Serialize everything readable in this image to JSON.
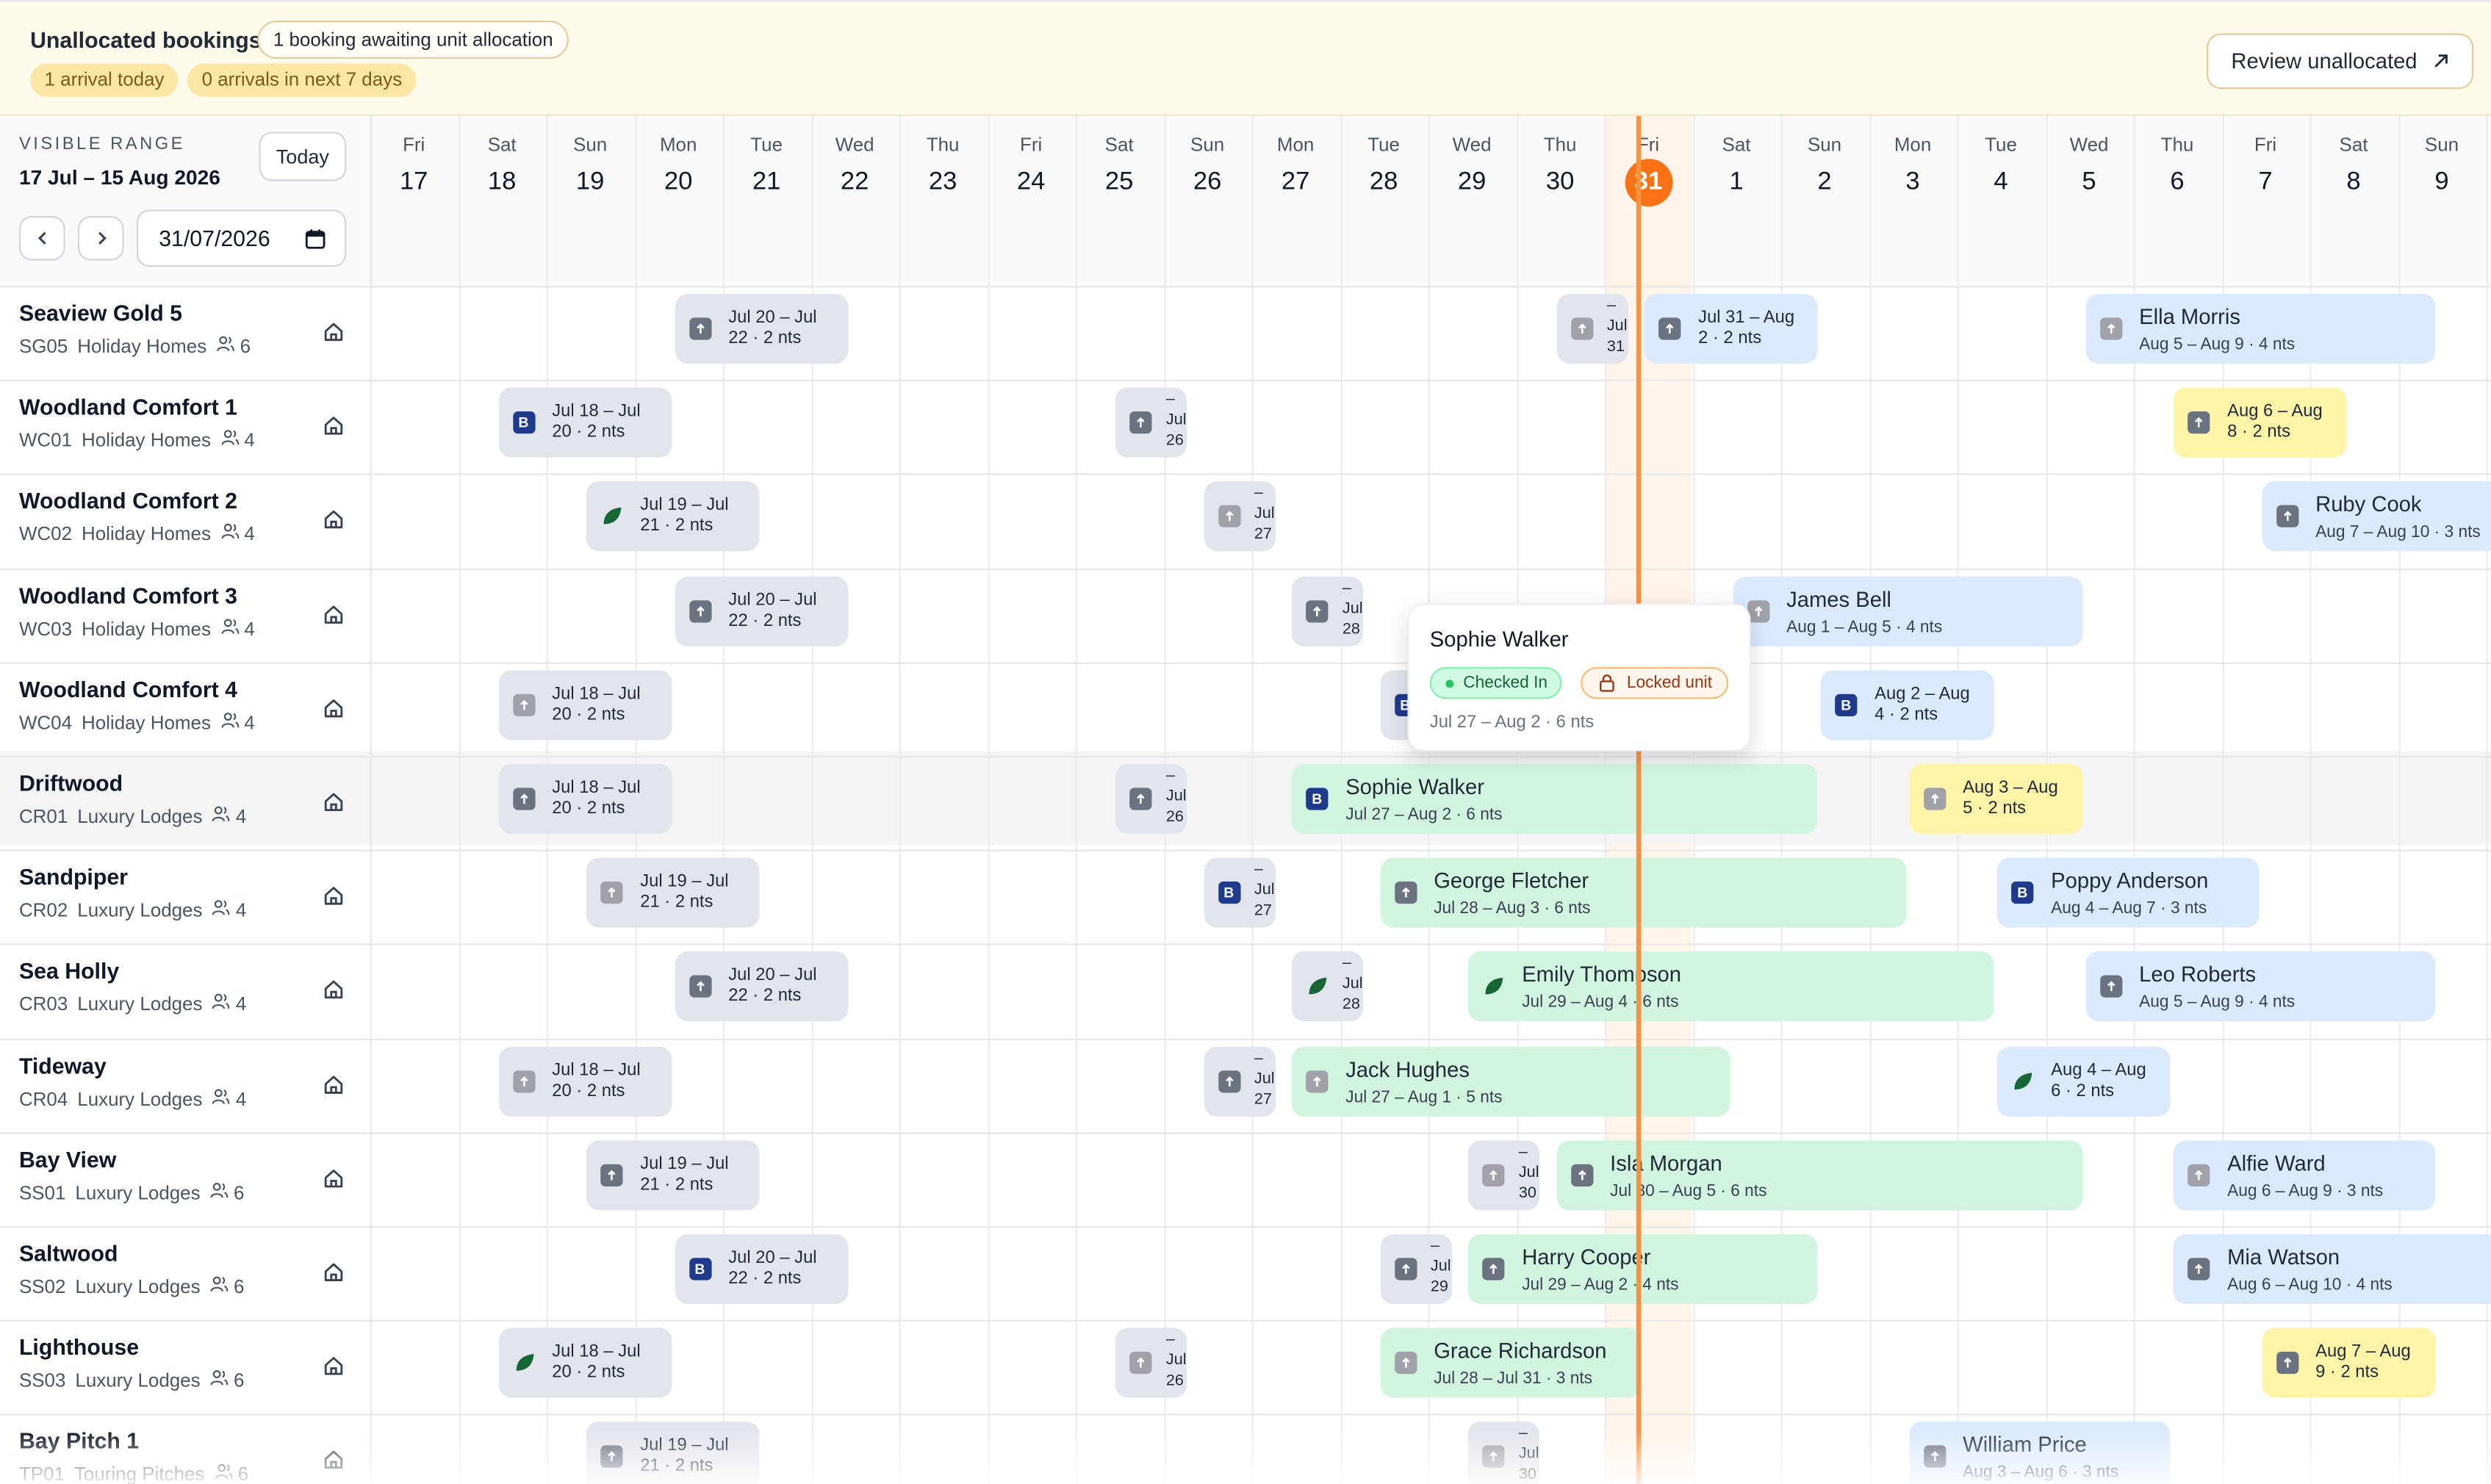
{
  "banner": {
    "title": "Unallocated bookings",
    "awaiting": "1 booking awaiting unit allocation",
    "arrivals_today": "1 arrival today",
    "arrivals_next": "0 arrivals in next 7 days",
    "review_label": "Review unallocated"
  },
  "range": {
    "label": "VISIBLE RANGE",
    "value": "17 Jul – 15 Aug 2026",
    "today_label": "Today",
    "date_value": "31/07/2026"
  },
  "days": [
    {
      "name": "Fri",
      "num": "17"
    },
    {
      "name": "Sat",
      "num": "18"
    },
    {
      "name": "Sun",
      "num": "19"
    },
    {
      "name": "Mon",
      "num": "20"
    },
    {
      "name": "Tue",
      "num": "21"
    },
    {
      "name": "Wed",
      "num": "22"
    },
    {
      "name": "Thu",
      "num": "23"
    },
    {
      "name": "Fri",
      "num": "24"
    },
    {
      "name": "Sat",
      "num": "25"
    },
    {
      "name": "Sun",
      "num": "26"
    },
    {
      "name": "Mon",
      "num": "27"
    },
    {
      "name": "Tue",
      "num": "28"
    },
    {
      "name": "Wed",
      "num": "29"
    },
    {
      "name": "Thu",
      "num": "30"
    },
    {
      "name": "Fri",
      "num": "31",
      "today": true
    },
    {
      "name": "Sat",
      "num": "1"
    },
    {
      "name": "Sun",
      "num": "2"
    },
    {
      "name": "Mon",
      "num": "3"
    },
    {
      "name": "Tue",
      "num": "4"
    },
    {
      "name": "Wed",
      "num": "5"
    },
    {
      "name": "Thu",
      "num": "6"
    },
    {
      "name": "Fri",
      "num": "7"
    },
    {
      "name": "Sat",
      "num": "8"
    },
    {
      "name": "Sun",
      "num": "9"
    }
  ],
  "units": [
    {
      "name": "Seaview Gold 5",
      "code": "SG05",
      "type": "Holiday Homes",
      "cap": "6"
    },
    {
      "name": "Woodland Comfort 1",
      "code": "WC01",
      "type": "Holiday Homes",
      "cap": "4"
    },
    {
      "name": "Woodland Comfort 2",
      "code": "WC02",
      "type": "Holiday Homes",
      "cap": "4"
    },
    {
      "name": "Woodland Comfort 3",
      "code": "WC03",
      "type": "Holiday Homes",
      "cap": "4"
    },
    {
      "name": "Woodland Comfort 4",
      "code": "WC04",
      "type": "Holiday Homes",
      "cap": "4"
    },
    {
      "name": "Driftwood",
      "code": "CR01",
      "type": "Luxury Lodges",
      "cap": "4"
    },
    {
      "name": "Sandpiper",
      "code": "CR02",
      "type": "Luxury Lodges",
      "cap": "4"
    },
    {
      "name": "Sea Holly",
      "code": "CR03",
      "type": "Luxury Lodges",
      "cap": "4"
    },
    {
      "name": "Tideway",
      "code": "CR04",
      "type": "Luxury Lodges",
      "cap": "4"
    },
    {
      "name": "Bay View",
      "code": "SS01",
      "type": "Luxury Lodges",
      "cap": "6"
    },
    {
      "name": "Saltwood",
      "code": "SS02",
      "type": "Luxury Lodges",
      "cap": "6"
    },
    {
      "name": "Lighthouse",
      "code": "SS03",
      "type": "Luxury Lodges",
      "cap": "6"
    },
    {
      "name": "Bay Pitch 1",
      "code": "TP01",
      "type": "Touring Pitches",
      "cap": "6"
    }
  ],
  "bookings": [
    {
      "row": 0,
      "start": 3,
      "len": 2,
      "color": "gray",
      "icon": "dark",
      "text": "Jul 20 – Jul\n22 · 2 nts"
    },
    {
      "row": 0,
      "start": 13,
      "len": 1,
      "color": "gray",
      "icon": "light",
      "text": "–\nJul\n31",
      "narrow": true
    },
    {
      "row": 0,
      "start": 14,
      "len": 2,
      "color": "blue",
      "icon": "dark",
      "text": "Jul 31 – Aug\n2 · 2 nts"
    },
    {
      "row": 0,
      "start": 19,
      "len": 4,
      "color": "blue",
      "icon": "light",
      "guest": "Ella Morris",
      "sub": "Aug 5 – Aug 9 · 4 nts"
    },
    {
      "row": 1,
      "start": 1,
      "len": 2,
      "color": "gray",
      "icon": "navy",
      "text": "Jul 18 – Jul\n20 · 2 nts"
    },
    {
      "row": 1,
      "start": 8,
      "len": 1,
      "color": "gray",
      "icon": "dark",
      "text": "–\nJul\n26",
      "narrow": true
    },
    {
      "row": 1,
      "start": 20,
      "len": 2,
      "color": "yellow",
      "icon": "dark",
      "text": "Aug 6 – Aug\n8 · 2 nts"
    },
    {
      "row": 2,
      "start": 2,
      "len": 2,
      "color": "gray",
      "icon": "leaf",
      "text": "Jul 19 – Jul\n21 · 2 nts"
    },
    {
      "row": 2,
      "start": 9,
      "len": 1,
      "color": "gray",
      "icon": "light",
      "text": "–\nJul\n27",
      "narrow": true
    },
    {
      "row": 2,
      "start": 21,
      "len": 3,
      "color": "blue",
      "icon": "dark",
      "guest": "Ruby Cook",
      "sub": "Aug 7 – Aug 10 · 3 nts"
    },
    {
      "row": 3,
      "start": 3,
      "len": 2,
      "color": "gray",
      "icon": "dark",
      "text": "Jul 20 – Jul\n22 · 2 nts"
    },
    {
      "row": 3,
      "start": 10,
      "len": 1,
      "color": "gray",
      "icon": "dark",
      "text": "–\nJul\n28",
      "narrow": true
    },
    {
      "row": 3,
      "start": 15,
      "len": 4,
      "color": "blue",
      "icon": "light",
      "guest": "James Bell",
      "sub": "Aug 1 – Aug 5 · 4 nts"
    },
    {
      "row": 4,
      "start": 1,
      "len": 2,
      "color": "gray",
      "icon": "light",
      "text": "Jul 18 – Jul\n20 · 2 nts"
    },
    {
      "row": 4,
      "start": 11,
      "len": 1,
      "color": "gray",
      "icon": "navy",
      "text": "",
      "narrow": true
    },
    {
      "row": 4,
      "start": 16,
      "len": 2,
      "color": "blue",
      "icon": "navy",
      "text": "Aug 2 – Aug\n4 · 2 nts"
    },
    {
      "row": 5,
      "start": 1,
      "len": 2,
      "color": "gray",
      "icon": "dark",
      "text": "Jul 18 – Jul\n20 · 2 nts"
    },
    {
      "row": 5,
      "start": 8,
      "len": 1,
      "color": "gray",
      "icon": "dark",
      "text": "–\nJul\n26",
      "narrow": true
    },
    {
      "row": 5,
      "start": 10,
      "len": 6,
      "color": "green",
      "icon": "navy",
      "guest": "Sophie Walker",
      "sub": "Jul 27 – Aug 2 · 6 nts"
    },
    {
      "row": 5,
      "start": 17,
      "len": 2,
      "color": "yellow",
      "icon": "light",
      "text": "Aug 3 – Aug\n5 · 2 nts"
    },
    {
      "row": 6,
      "start": 2,
      "len": 2,
      "color": "gray",
      "icon": "light",
      "text": "Jul 19 – Jul\n21 · 2 nts"
    },
    {
      "row": 6,
      "start": 9,
      "len": 1,
      "color": "gray",
      "icon": "navy",
      "text": "–\nJul\n27",
      "narrow": true
    },
    {
      "row": 6,
      "start": 11,
      "len": 6,
      "color": "green",
      "icon": "dark",
      "guest": "George Fletcher",
      "sub": "Jul 28 – Aug 3 · 6 nts"
    },
    {
      "row": 6,
      "start": 18,
      "len": 3,
      "color": "blue",
      "icon": "navy",
      "guest": "Poppy Anderson",
      "sub": "Aug 4 – Aug 7 · 3 nts"
    },
    {
      "row": 7,
      "start": 3,
      "len": 2,
      "color": "gray",
      "icon": "dark",
      "text": "Jul 20 – Jul\n22 · 2 nts"
    },
    {
      "row": 7,
      "start": 10,
      "len": 1,
      "color": "gray",
      "icon": "leaf",
      "text": "–\nJul\n28",
      "narrow": true
    },
    {
      "row": 7,
      "start": 12,
      "len": 6,
      "color": "green",
      "icon": "leaf",
      "guest": "Emily Thompson",
      "sub": "Jul 29 – Aug 4 · 6 nts"
    },
    {
      "row": 7,
      "start": 19,
      "len": 4,
      "color": "blue",
      "icon": "dark",
      "guest": "Leo Roberts",
      "sub": "Aug 5 – Aug 9 · 4 nts"
    },
    {
      "row": 8,
      "start": 1,
      "len": 2,
      "color": "gray",
      "icon": "light",
      "text": "Jul 18 – Jul\n20 · 2 nts"
    },
    {
      "row": 8,
      "start": 9,
      "len": 1,
      "color": "gray",
      "icon": "dark",
      "text": "–\nJul\n27",
      "narrow": true
    },
    {
      "row": 8,
      "start": 10,
      "len": 5,
      "color": "green",
      "icon": "light",
      "guest": "Jack Hughes",
      "sub": "Jul 27 – Aug 1 · 5 nts"
    },
    {
      "row": 8,
      "start": 18,
      "len": 2,
      "color": "blue",
      "icon": "leaf",
      "text": "Aug 4 – Aug\n6 · 2 nts"
    },
    {
      "row": 9,
      "start": 2,
      "len": 2,
      "color": "gray",
      "icon": "dark",
      "text": "Jul 19 – Jul\n21 · 2 nts"
    },
    {
      "row": 9,
      "start": 12,
      "len": 1,
      "color": "gray",
      "icon": "light",
      "text": "–\nJul\n30",
      "narrow": true
    },
    {
      "row": 9,
      "start": 13,
      "len": 6,
      "color": "green",
      "icon": "dark",
      "guest": "Isla Morgan",
      "sub": "Jul 30 – Aug 5 · 6 nts"
    },
    {
      "row": 9,
      "start": 20,
      "len": 3,
      "color": "blue",
      "icon": "light",
      "guest": "Alfie Ward",
      "sub": "Aug 6 – Aug 9 · 3 nts"
    },
    {
      "row": 10,
      "start": 3,
      "len": 2,
      "color": "gray",
      "icon": "navy",
      "text": "Jul 20 – Jul\n22 · 2 nts"
    },
    {
      "row": 10,
      "start": 11,
      "len": 1,
      "color": "gray",
      "icon": "dark",
      "text": "–\nJul\n29",
      "narrow": true
    },
    {
      "row": 10,
      "start": 12,
      "len": 4,
      "color": "green",
      "icon": "dark",
      "guest": "Harry Cooper",
      "sub": "Jul 29 – Aug 2 · 4 nts"
    },
    {
      "row": 10,
      "start": 20,
      "len": 4,
      "color": "blue",
      "icon": "dark",
      "guest": "Mia Watson",
      "sub": "Aug 6 – Aug 10 · 4 nts"
    },
    {
      "row": 11,
      "start": 1,
      "len": 2,
      "color": "gray",
      "icon": "leaf",
      "text": "Jul 18 – Jul\n20 · 2 nts"
    },
    {
      "row": 11,
      "start": 8,
      "len": 1,
      "color": "gray",
      "icon": "light",
      "text": "–\nJul\n26",
      "narrow": true
    },
    {
      "row": 11,
      "start": 11,
      "len": 3,
      "color": "green",
      "icon": "light",
      "guest": "Grace Richardson",
      "sub": "Jul 28 – Jul 31 · 3 nts"
    },
    {
      "row": 11,
      "start": 21,
      "len": 2,
      "color": "yellow",
      "icon": "dark",
      "text": "Aug 7 – Aug\n9 · 2 nts"
    },
    {
      "row": 12,
      "start": 2,
      "len": 2,
      "color": "gray",
      "icon": "dark",
      "text": "Jul 19 – Jul\n21 · 2 nts"
    },
    {
      "row": 12,
      "start": 12,
      "len": 1,
      "color": "gray",
      "icon": "light",
      "text": "–\nJul\n30",
      "narrow": true
    },
    {
      "row": 12,
      "start": 17,
      "len": 3,
      "color": "blue",
      "icon": "dark",
      "guest": "William Price",
      "sub": "Aug 3 – Aug 6 · 3 nts"
    }
  ],
  "tooltip": {
    "guest": "Sophie Walker",
    "status": "Checked In",
    "lock": "Locked unit",
    "dates": "Jul 27 – Aug 2 · 6 nts"
  },
  "colors": {
    "accent": "#f97316",
    "banner_bg": "#fffbeb",
    "green": "#d1f5df",
    "blue": "#dbeafe",
    "gray": "#e2e5ec",
    "yellow": "#fdf4a8"
  }
}
